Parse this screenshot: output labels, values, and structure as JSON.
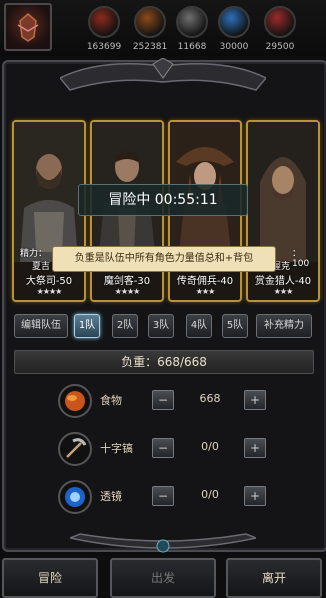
{
  "resources": [
    {
      "name": "food-resource",
      "value": "163699",
      "color": "#8a2a1e"
    },
    {
      "name": "wood-resource",
      "value": "252381",
      "color": "#8b4a1a"
    },
    {
      "name": "ore-resource",
      "value": "11668",
      "color": "#6f6f6f"
    },
    {
      "name": "crystal-resource",
      "value": "30000",
      "color": "#2d6fb8"
    },
    {
      "name": "gold-resource",
      "value": "29500",
      "color": "#9a2a2a"
    }
  ],
  "party": [
    {
      "label": "大祭司-50",
      "stars": "★★★★",
      "upper_left": "精力：",
      "upper_sub": "夏吉"
    },
    {
      "label": "魔剑客-30",
      "stars": "★★★★"
    },
    {
      "label": "传奇佣兵-40",
      "stars": "★★★"
    },
    {
      "label": "赏金猎人-40",
      "stars": "★★★",
      "upper_right": "：100",
      "upper_sub": "渥克"
    }
  ],
  "adventure_status": "冒险中 00:55:11",
  "tooltip": "负重是队伍中所有角色力量值总和+背包",
  "controls": {
    "edit_team": "编辑队伍",
    "tabs": [
      "1队",
      "2队",
      "3队",
      "4队",
      "5队"
    ],
    "active_tab": "1队",
    "refill": "补充精力"
  },
  "load_text": "负重：668/668",
  "items": [
    {
      "name": "食物",
      "value": "668",
      "icon": "food-icon"
    },
    {
      "name": "十字镐",
      "value": "0/0",
      "icon": "pickaxe-icon"
    },
    {
      "name": "透镜",
      "value": "0/0",
      "icon": "lens-icon"
    }
  ],
  "stepper": {
    "minus": "−",
    "plus": "+"
  },
  "bottom": {
    "left": "冒险",
    "middle": "出发",
    "right": "离开"
  }
}
